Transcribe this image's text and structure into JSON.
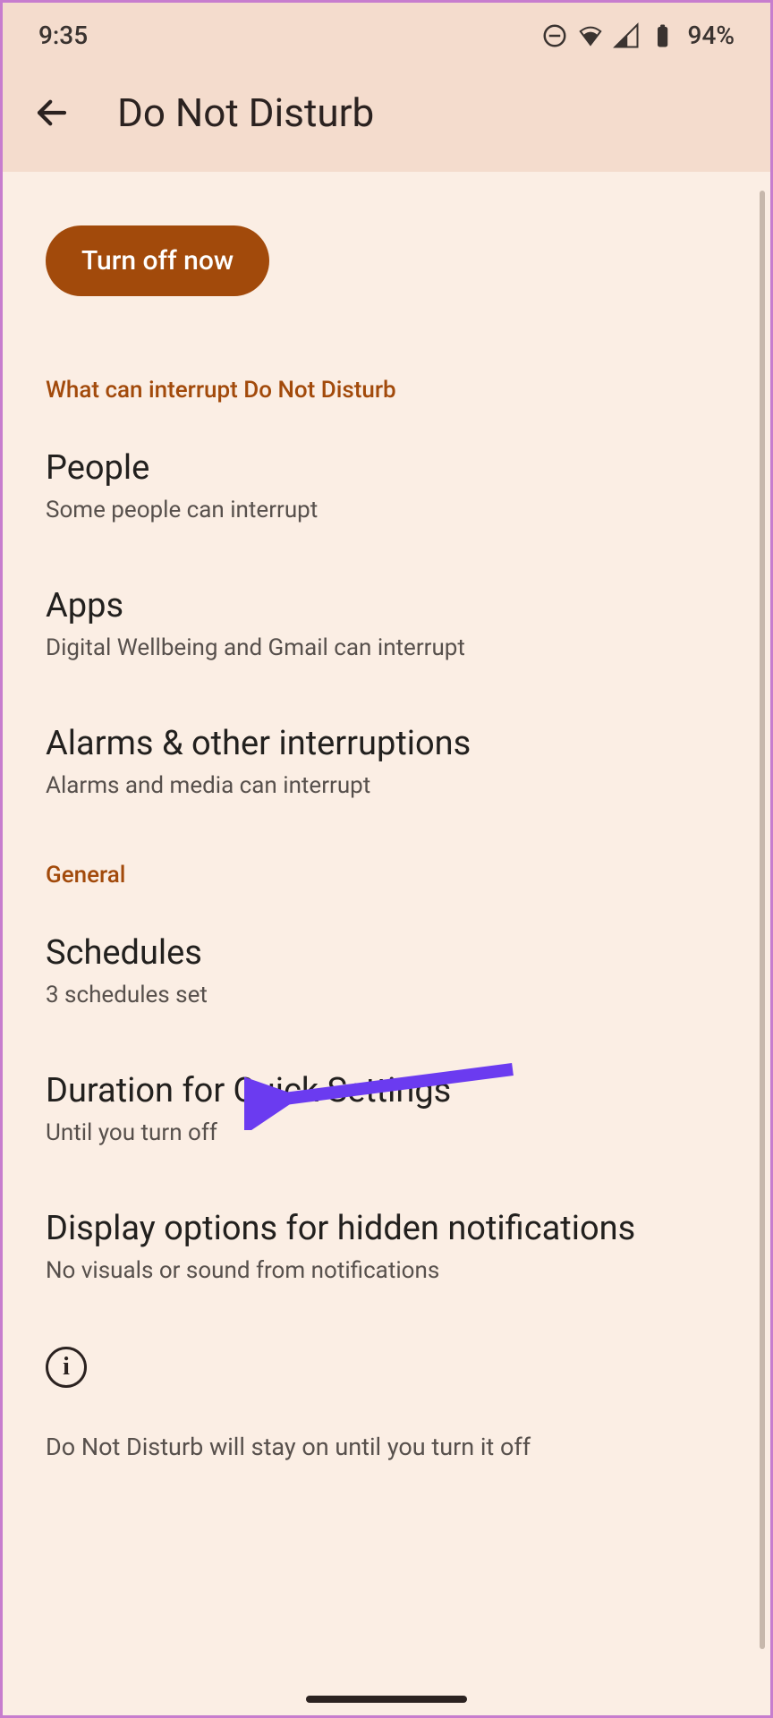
{
  "status_bar": {
    "time": "9:35",
    "battery": "94%"
  },
  "header": {
    "title": "Do Not Disturb"
  },
  "main": {
    "turn_off_label": "Turn off now",
    "sections": [
      {
        "header": "What can interrupt Do Not Disturb",
        "items": [
          {
            "title": "People",
            "subtitle": "Some people can interrupt"
          },
          {
            "title": "Apps",
            "subtitle": "Digital Wellbeing and Gmail can interrupt"
          },
          {
            "title": "Alarms & other interruptions",
            "subtitle": "Alarms and media can interrupt"
          }
        ]
      },
      {
        "header": "General",
        "items": [
          {
            "title": "Schedules",
            "subtitle": "3 schedules set"
          },
          {
            "title": "Duration for Quick Settings",
            "subtitle": "Until you turn off"
          },
          {
            "title": "Display options for hidden notifications",
            "subtitle": "No visuals or sound from notifications"
          }
        ]
      }
    ],
    "status_text": "Do Not Disturb will stay on until you turn it off"
  },
  "annotation": {
    "arrow_color": "#6B3BF0"
  }
}
